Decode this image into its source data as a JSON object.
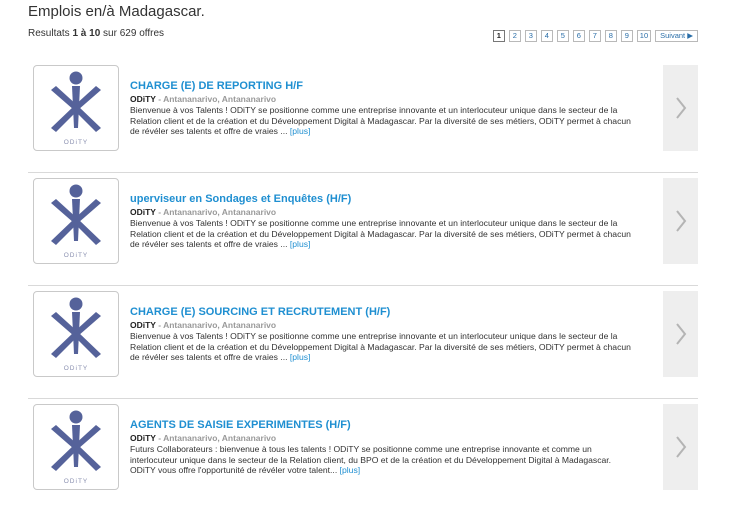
{
  "page": {
    "title": "Emplois en/à Madagascar.",
    "results_prefix": "Resultats ",
    "results_range": "1 à 10",
    "results_suffix": " sur 629 offres"
  },
  "pagination": {
    "pages": [
      "1",
      "2",
      "3",
      "4",
      "5",
      "6",
      "7",
      "8",
      "9",
      "10"
    ],
    "current": "1",
    "next_label": "Suivant ▶"
  },
  "jobs": [
    {
      "title": "CHARGE (E) DE REPORTING H/F",
      "company": "ODiTY",
      "location": " - Antananarivo, Antananarivo",
      "description": "Bienvenue à vos Talents ! ODiTY se positionne comme une entreprise innovante et un interlocuteur unique dans le secteur de la Relation client et de la création et du Développement Digital à Madagascar. Par la diversité de ses métiers, ODiTY permet à chacun de révéler ses talents et offre de vraies ... ",
      "more": "[plus]",
      "logo_text": "ODiTY"
    },
    {
      "title": "uperviseur en Sondages et Enquêtes (H/F)",
      "company": "ODiTY",
      "location": " - Antananarivo, Antananarivo",
      "description": "Bienvenue à vos Talents ! ODiTY se positionne comme une entreprise innovante et un interlocuteur unique dans le secteur de la Relation client et de la création et du Développement Digital à Madagascar. Par la diversité de ses métiers, ODiTY permet à chacun de révéler ses talents et offre de vraies ... ",
      "more": "[plus]",
      "logo_text": "ODiTY"
    },
    {
      "title": "CHARGE (E) SOURCING ET RECRUTEMENT (H/F)",
      "company": "ODiTY",
      "location": " - Antananarivo, Antananarivo",
      "description": "Bienvenue à vos Talents ! ODiTY se positionne comme une entreprise innovante et un interlocuteur unique dans le secteur de la Relation client et de la création et du Développement Digital à Madagascar. Par la diversité de ses métiers, ODiTY permet à chacun de révéler ses talents et offre de vraies ... ",
      "more": "[plus]",
      "logo_text": "ODiTY"
    },
    {
      "title": "AGENTS DE SAISIE EXPERIMENTES (H/F)",
      "company": "ODiTY",
      "location": " - Antananarivo, Antananarivo",
      "description": "Futurs Collaborateurs : bienvenue à tous les talents ! ODiTY se positionne comme une entreprise innovante et comme un interlocuteur unique dans le secteur de la Relation client, du BPO et de la création et du Développement Digital à Madagascar. ODiTY vous offre l'opportunité de révéler votre talent... ",
      "more": "[plus]",
      "logo_text": "ODiTY"
    }
  ],
  "icons": {
    "logo": "odity-logo-icon",
    "arrow": "chevron-right-icon"
  },
  "colors": {
    "title_link": "#1f8fd1",
    "logo_blue": "#55629a",
    "arrow_panel": "#eeeeee"
  }
}
